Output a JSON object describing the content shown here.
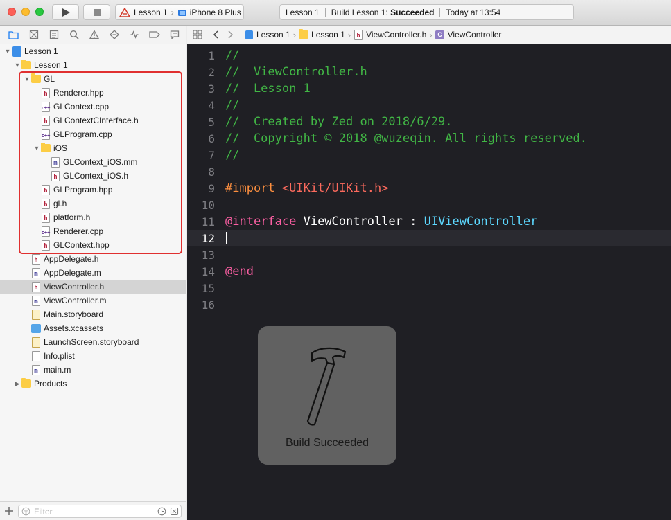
{
  "toolbar": {
    "scheme": {
      "project": "Lesson 1",
      "device": "iPhone 8 Plus"
    },
    "activity": {
      "project": "Lesson 1",
      "status_prefix": "Build Lesson 1: ",
      "status_result": "Succeeded",
      "time": "Today at 13:54"
    }
  },
  "navigator": {
    "tree": [
      {
        "label": "Lesson 1",
        "icon": "project-icon",
        "level": 0,
        "expanded": true
      },
      {
        "label": "Lesson 1",
        "icon": "folder-icon",
        "level": 1,
        "expanded": true
      },
      {
        "label": "GL",
        "icon": "folder-icon",
        "level": 2,
        "expanded": true
      },
      {
        "label": "Renderer.hpp",
        "icon": "h-file-icon",
        "level": 3
      },
      {
        "label": "GLContext.cpp",
        "icon": "cpp-file-icon",
        "level": 3
      },
      {
        "label": "GLContextCInterface.h",
        "icon": "h-file-icon",
        "level": 3
      },
      {
        "label": "GLProgram.cpp",
        "icon": "cpp-file-icon",
        "level": 3
      },
      {
        "label": "iOS",
        "icon": "folder-icon",
        "level": 3,
        "expanded": true
      },
      {
        "label": "GLContext_iOS.mm",
        "icon": "m-file-icon",
        "level": 4
      },
      {
        "label": "GLContext_iOS.h",
        "icon": "h-file-icon",
        "level": 4
      },
      {
        "label": "GLProgram.hpp",
        "icon": "h-file-icon",
        "level": 3
      },
      {
        "label": "gl.h",
        "icon": "h-file-icon",
        "level": 3
      },
      {
        "label": "platform.h",
        "icon": "h-file-icon",
        "level": 3
      },
      {
        "label": "Renderer.cpp",
        "icon": "cpp-file-icon",
        "level": 3
      },
      {
        "label": "GLContext.hpp",
        "icon": "h-file-icon",
        "level": 3
      },
      {
        "label": "AppDelegate.h",
        "icon": "h-file-icon",
        "level": 2
      },
      {
        "label": "AppDelegate.m",
        "icon": "m-file-icon",
        "level": 2
      },
      {
        "label": "ViewController.h",
        "icon": "h-file-icon",
        "level": 2,
        "selected": true
      },
      {
        "label": "ViewController.m",
        "icon": "m-file-icon",
        "level": 2
      },
      {
        "label": "Main.storyboard",
        "icon": "storyboard-icon",
        "level": 2
      },
      {
        "label": "Assets.xcassets",
        "icon": "assets-icon",
        "level": 2
      },
      {
        "label": "LaunchScreen.storyboard",
        "icon": "storyboard-icon",
        "level": 2
      },
      {
        "label": "Info.plist",
        "icon": "plist-icon",
        "level": 2
      },
      {
        "label": "main.m",
        "icon": "m-file-icon",
        "level": 2
      },
      {
        "label": "Products",
        "icon": "folder-icon",
        "level": 1,
        "expanded": false
      }
    ],
    "filter_placeholder": "Filter"
  },
  "jumpbar": {
    "crumbs": [
      "Lesson 1",
      "Lesson 1",
      "ViewController.h",
      "ViewController"
    ]
  },
  "editor": {
    "current_line": 12,
    "lines": [
      [
        {
          "t": "//",
          "c": "cm"
        }
      ],
      [
        {
          "t": "//  ViewController.h",
          "c": "cm"
        }
      ],
      [
        {
          "t": "//  Lesson 1",
          "c": "cm"
        }
      ],
      [
        {
          "t": "//",
          "c": "cm"
        }
      ],
      [
        {
          "t": "//  Created by Zed on 2018/6/29.",
          "c": "cm"
        }
      ],
      [
        {
          "t": "//  Copyright © 2018 @wuzeqin. All rights reserved.",
          "c": "cm"
        }
      ],
      [
        {
          "t": "//",
          "c": "cm"
        }
      ],
      [],
      [
        {
          "t": "#import ",
          "c": "pp"
        },
        {
          "t": "<UIKit/UIKit.h>",
          "c": "str"
        }
      ],
      [],
      [
        {
          "t": "@interface",
          "c": "kw"
        },
        {
          "t": " ViewController : ",
          "c": "pl"
        },
        {
          "t": "UIViewController",
          "c": "cls"
        }
      ],
      [],
      [],
      [
        {
          "t": "@end",
          "c": "kw"
        }
      ],
      [],
      []
    ]
  },
  "hud": {
    "text": "Build Succeeded"
  }
}
